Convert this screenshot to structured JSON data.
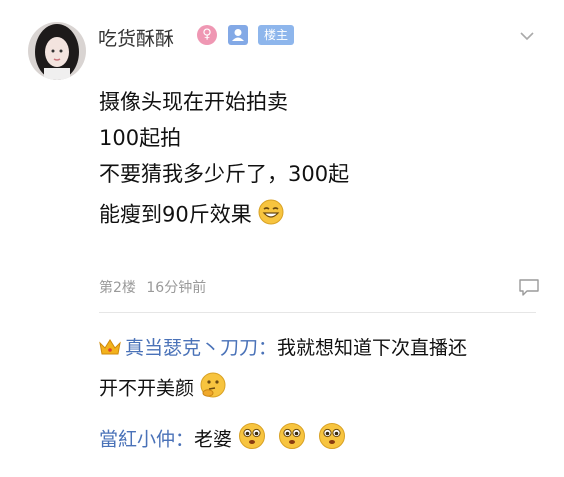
{
  "post": {
    "username": "吃货酥酥",
    "badges": {
      "gender_icon": "female-symbol-icon",
      "user_icon": "user-avatar-icon",
      "op_label": "楼主"
    },
    "lines": [
      "摄像头现在开始拍卖",
      "100起拍",
      "不要猜我多少斤了，300起",
      "能瘦到90斤效果"
    ],
    "end_emoji": "grinning-emoji-icon",
    "floor": "第2楼",
    "time": "16分钟前"
  },
  "replies": [
    {
      "name": "真当瑟克丶刀刀：",
      "text_line1": "我就想知道下次直播还",
      "text_line2": "开不开美颜",
      "badge_icon": "crown-icon",
      "end_emoji": "thinking-emoji-icon"
    },
    {
      "name": "當紅小仲：",
      "text": "老婆",
      "end_emojis": [
        "star-eyed-emoji-icon",
        "star-eyed-emoji-icon",
        "star-eyed-emoji-icon"
      ]
    }
  ],
  "colors": {
    "name_blue": "#4a72b8",
    "badge_pink": "#ef97b3",
    "badge_blue": "#8eb6ec",
    "meta_gray": "#9a9a9a"
  }
}
